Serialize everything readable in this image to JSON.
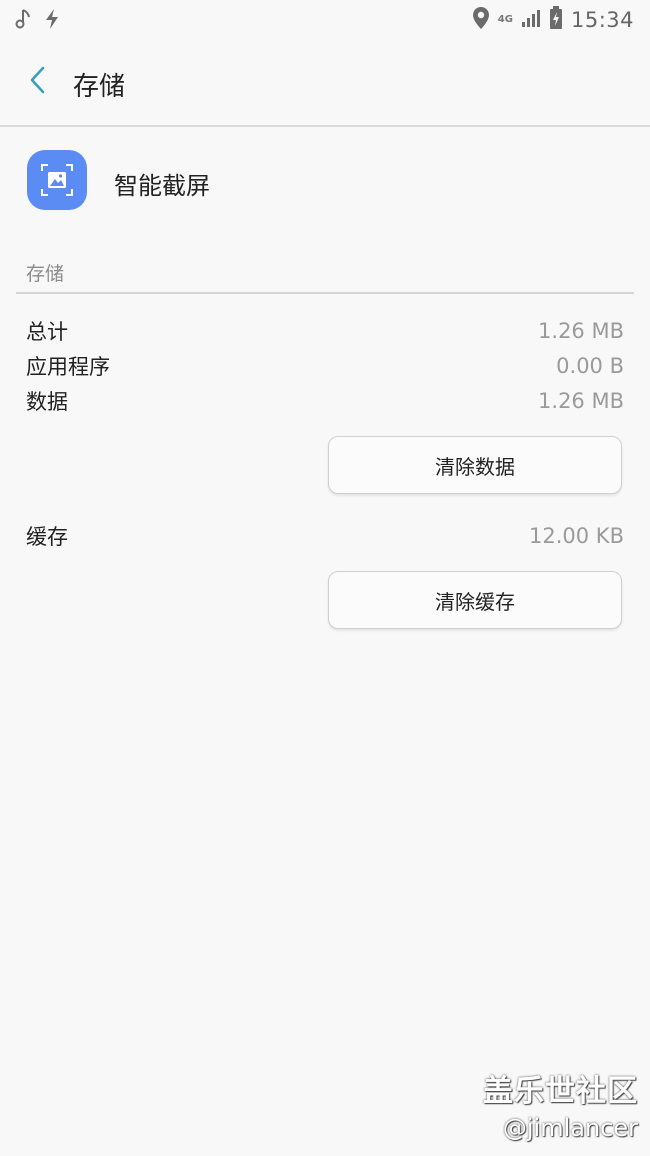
{
  "status_bar": {
    "left_icons": [
      "music-note-icon",
      "flash-icon"
    ],
    "right_icons": [
      "location-icon",
      "signal-icon",
      "battery-charging-icon"
    ],
    "network": "4G",
    "time": "15:34"
  },
  "app_bar": {
    "back_icon": "chevron-left-icon",
    "title": "存储",
    "accent_color": "#3aa0b8"
  },
  "app_info": {
    "name": "智能截屏",
    "icon": "screenshot-gallery-icon",
    "icon_color": "#5b8cf4"
  },
  "storage": {
    "section_label": "存储",
    "rows": [
      {
        "label": "总计",
        "value": "1.26 MB"
      },
      {
        "label": "应用程序",
        "value": "0.00 B"
      },
      {
        "label": "数据",
        "value": "1.26 MB"
      }
    ],
    "clear_data_label": "清除数据"
  },
  "cache": {
    "label": "缓存",
    "value": "12.00 KB",
    "clear_cache_label": "清除缓存"
  },
  "watermark": {
    "main": "盖乐世社区",
    "sub": "@jimlancer"
  }
}
